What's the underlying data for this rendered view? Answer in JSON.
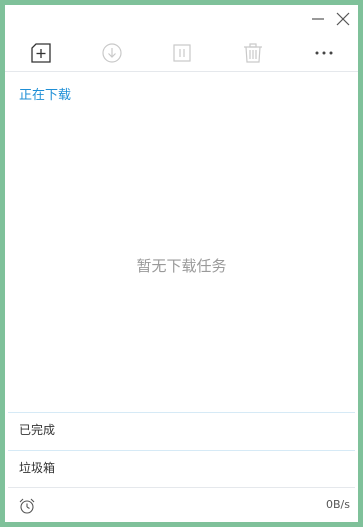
{
  "titlebar": {
    "minimize_icon": "minimize-icon",
    "close_icon": "close-icon"
  },
  "toolbar": {
    "icons": [
      "new-task-icon",
      "start-download-icon",
      "pause-icon",
      "delete-icon",
      "more-icon"
    ]
  },
  "downloading": {
    "title": "正在下载",
    "empty_text": "暂无下载任务"
  },
  "sections": {
    "completed": "已完成",
    "trash": "垃圾箱"
  },
  "footer": {
    "alarm_icon": "alarm-clock-icon",
    "speed": "0B/s"
  },
  "colors": {
    "accent": "#1f8fd6",
    "frame": "#7fc19a"
  }
}
